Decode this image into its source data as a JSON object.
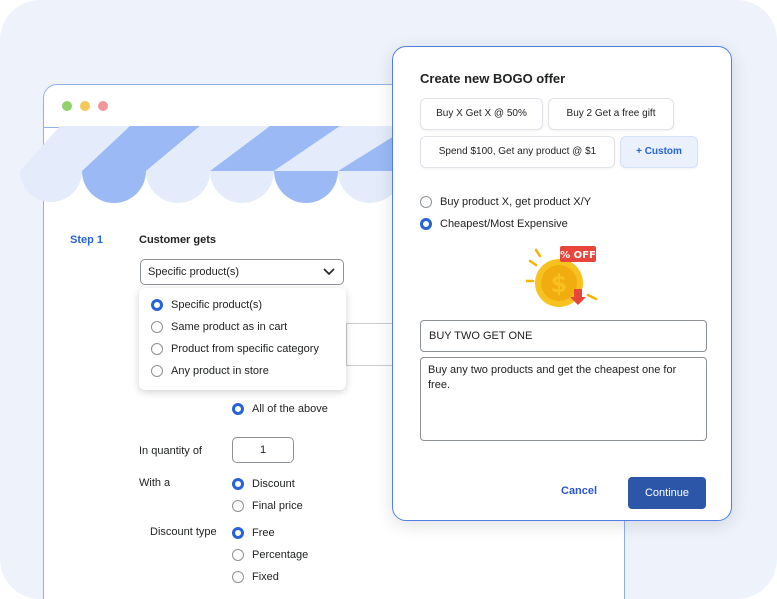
{
  "form": {
    "step_label": "Step 1",
    "section_title": "Customer gets",
    "select_value": "Specific product(s)",
    "dropdown_options": [
      {
        "label": "Specific product(s)",
        "selected": true
      },
      {
        "label": "Same product as in cart",
        "selected": false
      },
      {
        "label": "Product from specific category",
        "selected": false
      },
      {
        "label": "Any product in store",
        "selected": false
      }
    ],
    "all_of_above_label": "All of the above",
    "quantity_label": "In quantity of",
    "quantity_value": "1",
    "with_a_label": "With a",
    "with_a_options": [
      "Discount",
      "Final price"
    ],
    "discount_type_label": "Discount type",
    "discount_type_options": [
      "Free",
      "Percentage",
      "Fixed"
    ]
  },
  "modal": {
    "title": "Create new BOGO offer",
    "templates": [
      "Buy X Get X @ 50%",
      "Buy 2 Get a free gift",
      "Spend $100, Get any product @ $1",
      "+ Custom"
    ],
    "offer_types": [
      {
        "label": "Buy product X, get product X/Y",
        "selected": false
      },
      {
        "label": "Cheapest/Most Expensive",
        "selected": true
      }
    ],
    "badge_text": "% OFF",
    "offer_name": "BUY TWO GET ONE",
    "offer_description": "Buy any two products and get the cheapest one for free.",
    "cancel_label": "Cancel",
    "continue_label": "Continue"
  },
  "colors": {
    "accent": "#2563d6",
    "primary_button": "#2c56a8",
    "awning_blue": "#9bbaf5",
    "awning_light": "#e4ecfb",
    "modal_border": "#4f7fe5"
  }
}
